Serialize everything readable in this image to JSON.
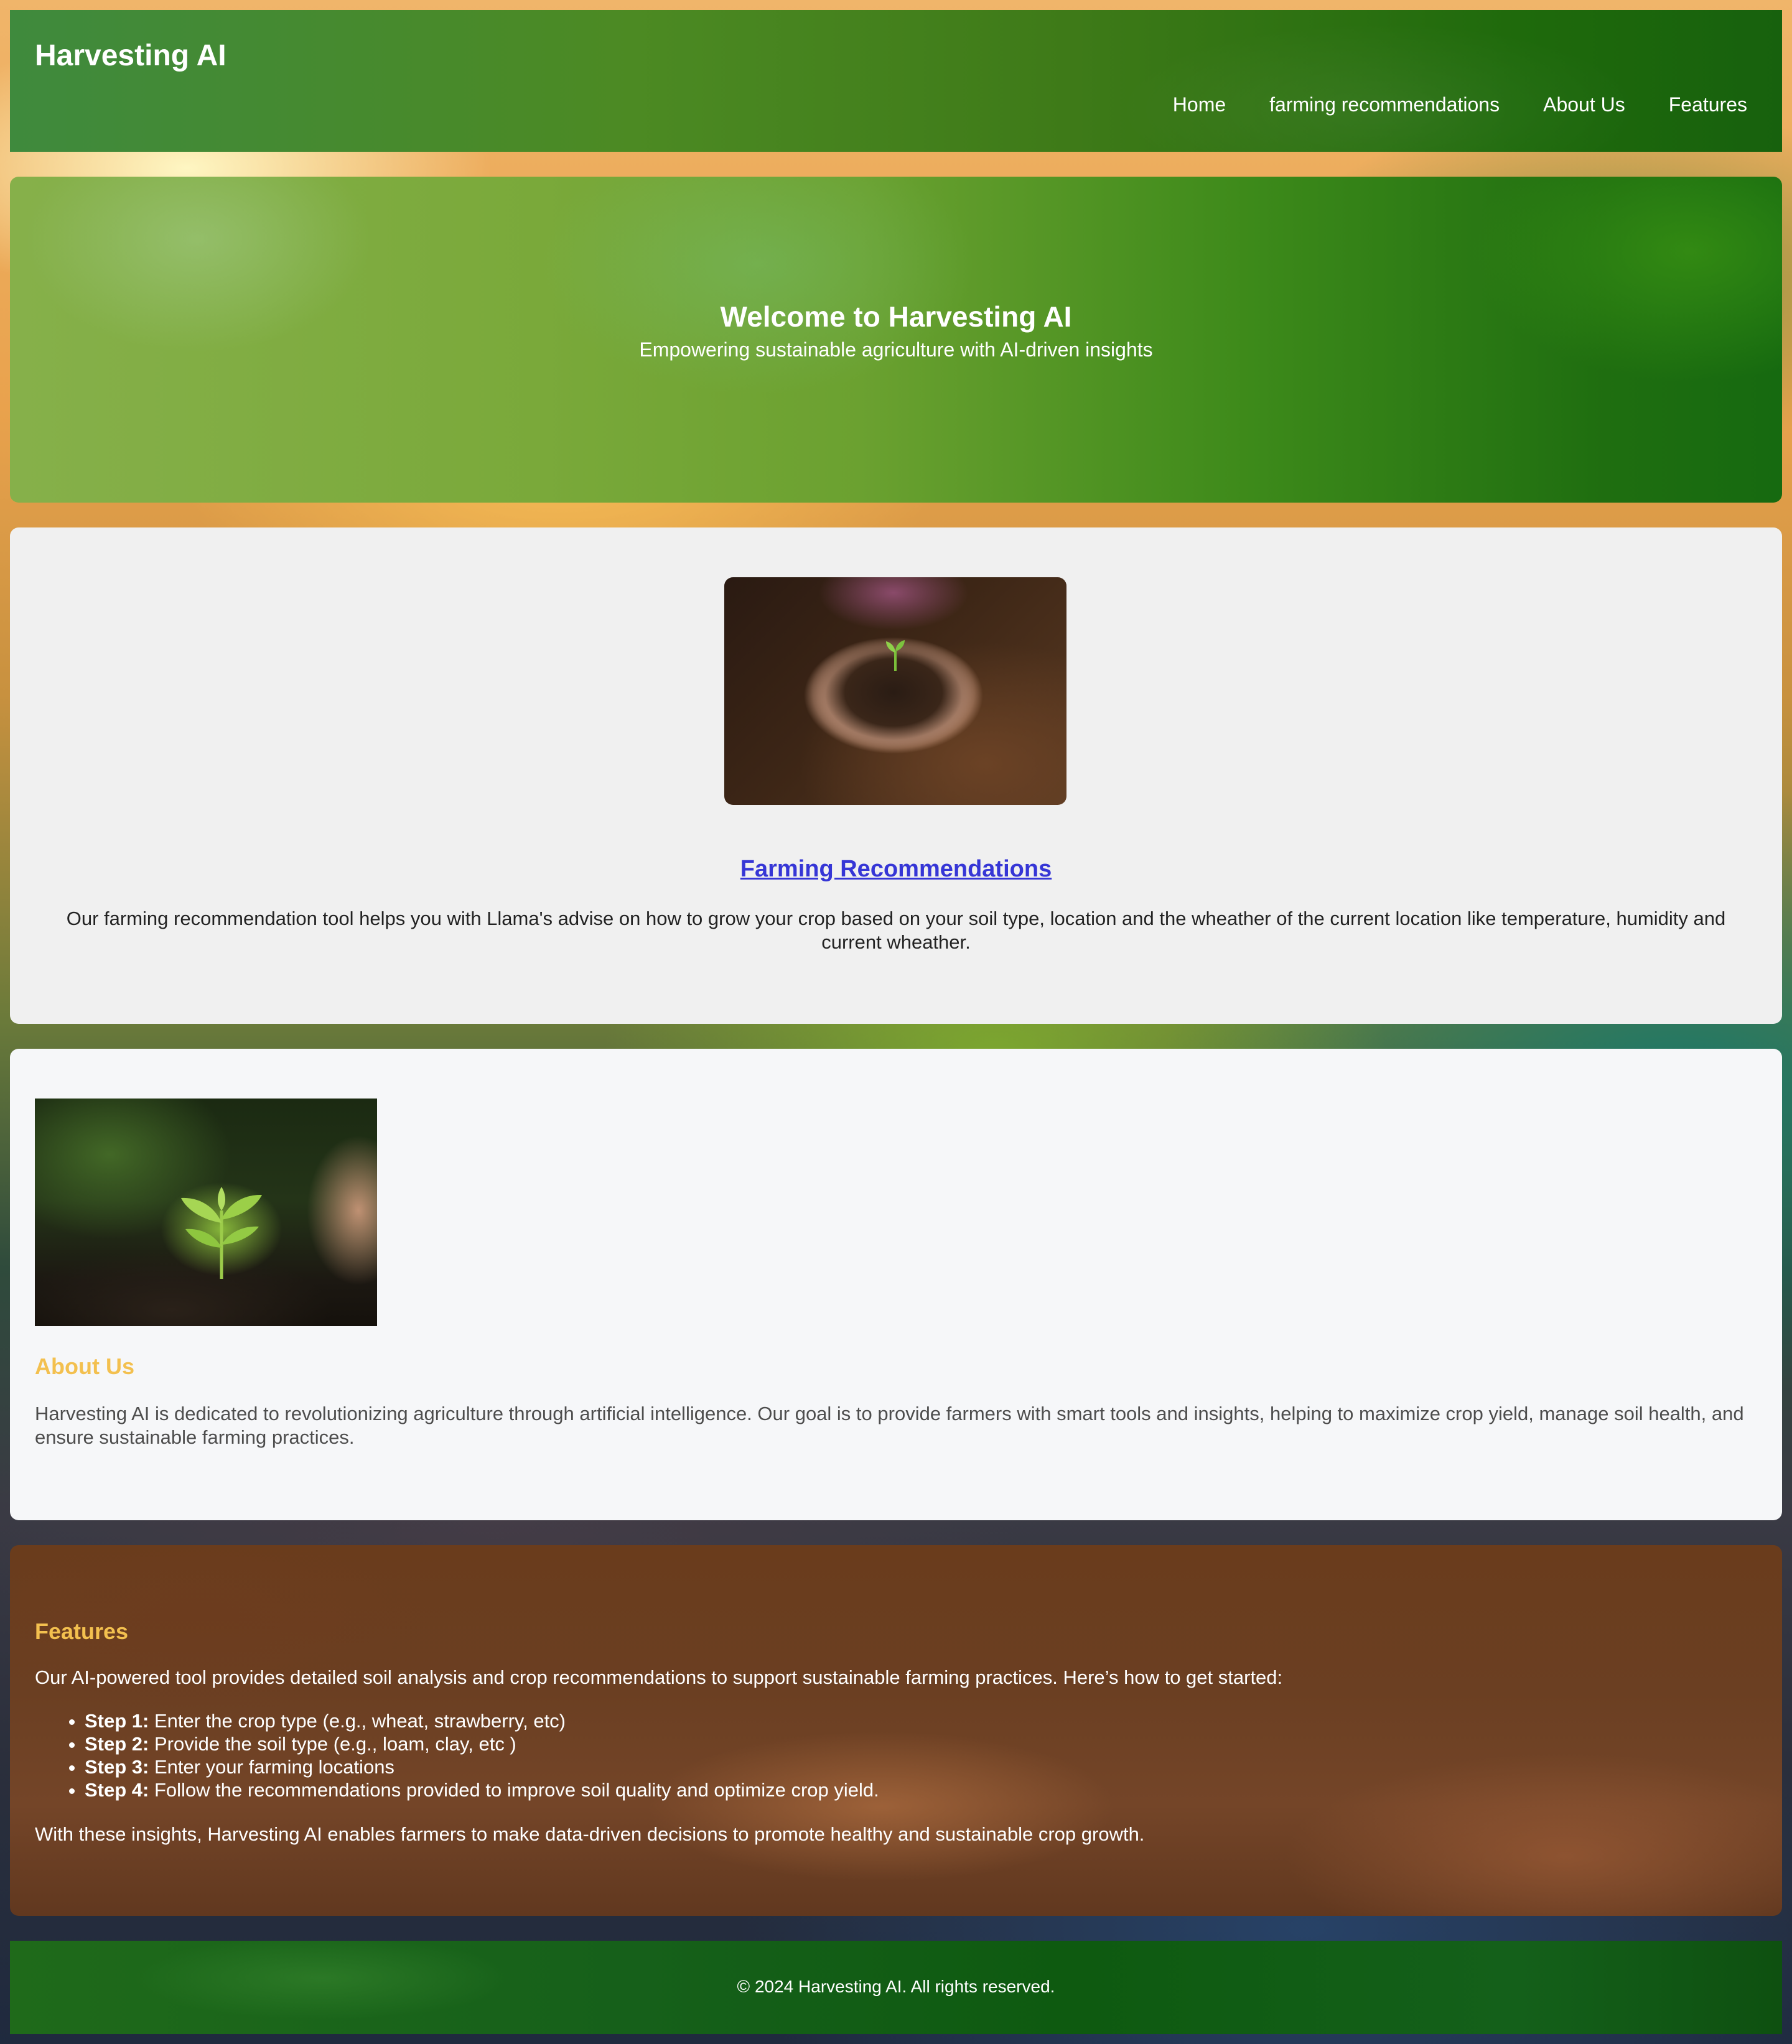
{
  "header": {
    "brand": "Harvesting AI",
    "nav": [
      "Home",
      "farming recommendations",
      "About Us",
      "Features"
    ]
  },
  "hero": {
    "title": "Welcome to Harvesting AI",
    "subtitle": "Empowering sustainable agriculture with AI-driven insights"
  },
  "recommendations": {
    "title": "Farming Recommendations",
    "description": "Our farming recommendation tool helps you with Llama's advise on how to grow your crop based on your soil type, location and the wheather of the current location like temperature, humidity and current wheather."
  },
  "about": {
    "title": "About Us",
    "text": "Harvesting AI is dedicated to revolutionizing agriculture through artificial intelligence. Our goal is to provide farmers with smart tools and insights, helping to maximize crop yield, manage soil health, and ensure sustainable farming practices."
  },
  "features": {
    "title": "Features",
    "intro": "Our AI-powered tool provides detailed soil analysis and crop recommendations to support sustainable farming practices. Here’s how to get started:",
    "steps": [
      {
        "label": "Step 1:",
        "text": " Enter the crop type (e.g., wheat, strawberry, etc)"
      },
      {
        "label": "Step 2:",
        "text": " Provide the soil type (e.g., loam, clay, etc )"
      },
      {
        "label": "Step 3:",
        "text": " Enter your farming locations"
      },
      {
        "label": "Step 4:",
        "text": " Follow the recommendations provided to improve soil quality and optimize crop yield."
      }
    ],
    "outro": "With these insights, Harvesting AI enables farmers to make data-driven decisions to promote healthy and sustainable crop growth."
  },
  "footer": {
    "text": "© 2024 Harvesting AI. All rights reserved."
  },
  "colors": {
    "header_green": "#2e7d32",
    "accent_gold": "#f3c04f",
    "link_blue": "#3636d6"
  }
}
